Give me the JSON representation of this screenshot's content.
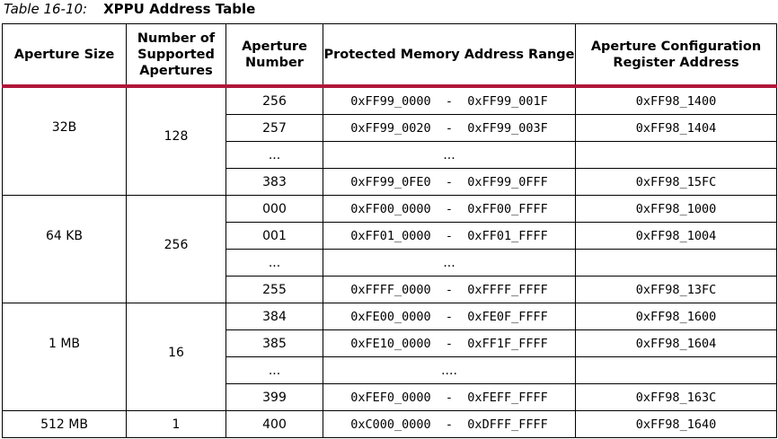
{
  "caption": {
    "number": "Table 16-10:",
    "title": "XPPU Address Table"
  },
  "headers": {
    "aperture_size": "Aperture Size",
    "num_supported": "Number of Supported Apertures",
    "aperture_number": "Aperture Number",
    "protected_range": "Protected Memory Address Range",
    "config_register": "Aperture Configuration Register Address"
  },
  "groups": [
    {
      "size": "32B",
      "count": "128",
      "rows": [
        {
          "number": "256",
          "range": "0xFF99_0000  -  0xFF99_001F",
          "register": "0xFF98_1400"
        },
        {
          "number": "257",
          "range": "0xFF99_0020  -  0xFF99_003F",
          "register": "0xFF98_1404"
        },
        {
          "number": "...",
          "range": "...",
          "register": ""
        },
        {
          "number": "383",
          "range": "0xFF99_0FE0  -  0xFF99_0FFF",
          "register": "0xFF98_15FC"
        }
      ]
    },
    {
      "size": "64 KB",
      "count": "256",
      "rows": [
        {
          "number": "000",
          "range": "0xFF00_0000  -  0xFF00_FFFF",
          "register": "0xFF98_1000"
        },
        {
          "number": "001",
          "range": "0xFF01_0000  -  0xFF01_FFFF",
          "register": "0xFF98_1004"
        },
        {
          "number": "...",
          "range": "...",
          "register": ""
        },
        {
          "number": "255",
          "range": "0xFFFF_0000  -  0xFFFF_FFFF",
          "register": "0xFF98_13FC"
        }
      ]
    },
    {
      "size": "1 MB",
      "count": "16",
      "rows": [
        {
          "number": "384",
          "range": "0xFE00_0000  -  0xFE0F_FFFF",
          "register": "0xFF98_1600"
        },
        {
          "number": "385",
          "range": "0xFE10_0000  -  0xFF1F_FFFF",
          "register": "0xFF98_1604"
        },
        {
          "number": "...",
          "range": "....",
          "register": ""
        },
        {
          "number": "399",
          "range": "0xFEF0_0000  -  0xFEFF_FFFF",
          "register": "0xFF98_163C"
        }
      ]
    },
    {
      "size": "512 MB",
      "count": "1",
      "rows": [
        {
          "number": "400",
          "range": "0xC000_0000  -  0xDFFF_FFFF",
          "register": "0xFF98_1640"
        }
      ]
    }
  ]
}
